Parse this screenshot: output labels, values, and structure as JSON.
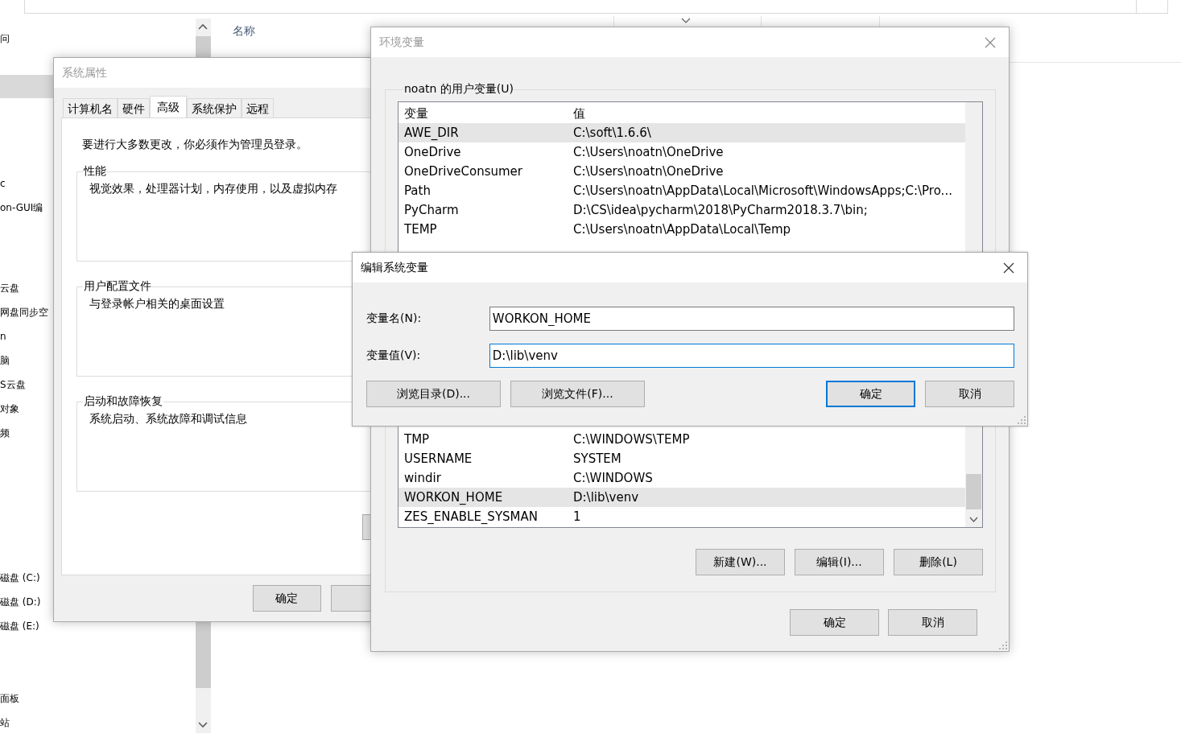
{
  "explorer": {
    "sidebar_sections": [
      {
        "items": [
          "问"
        ]
      },
      {
        "items": [
          "c",
          "on-GUI编"
        ]
      },
      {
        "items": [
          "云盘",
          "网盘同步空",
          "n",
          "脑",
          "S云盘",
          "对象",
          "频"
        ]
      },
      {
        "items": [
          "磁盘 (C:)",
          "磁盘 (D:)",
          "磁盘 (E:)"
        ]
      },
      {
        "items": [
          "面板",
          "站"
        ]
      }
    ],
    "column_header": "名称"
  },
  "system_properties": {
    "title": "系统属性",
    "tabs": [
      {
        "label": "计算机名",
        "selected": false
      },
      {
        "label": "硬件",
        "selected": false
      },
      {
        "label": "高级",
        "selected": true
      },
      {
        "label": "系统保护",
        "selected": false
      },
      {
        "label": "远程",
        "selected": false
      }
    ],
    "notice": "要进行大多数更改，你必须作为管理员登录。",
    "groups": [
      {
        "title": "性能",
        "description": "视觉效果，处理器计划，内存使用，以及虚拟内存"
      },
      {
        "title": "用户配置文件",
        "description": "与登录帐户相关的桌面设置"
      },
      {
        "title": "启动和故障恢复",
        "description": "系统启动、系统故障和调试信息"
      }
    ],
    "buttons": [
      "确定"
    ]
  },
  "environment_variables": {
    "title": "环境变量",
    "user_group_label": "noatn 的用户变量(U)",
    "user_variables": {
      "columns": [
        "变量",
        "值"
      ],
      "rows": [
        {
          "name": "AWE_DIR",
          "value": "C:\\soft\\1.6.6\\",
          "selected": true
        },
        {
          "name": "OneDrive",
          "value": "C:\\Users\\noatn\\OneDrive",
          "selected": false
        },
        {
          "name": "OneDriveConsumer",
          "value": "C:\\Users\\noatn\\OneDrive",
          "selected": false
        },
        {
          "name": "Path",
          "value": "C:\\Users\\noatn\\AppData\\Local\\Microsoft\\WindowsApps;C:\\Pro...",
          "selected": false
        },
        {
          "name": "PyCharm",
          "value": "D:\\CS\\idea\\pycharm\\2018\\PyCharm2018.3.7\\bin;",
          "selected": false
        },
        {
          "name": "TEMP",
          "value": "C:\\Users\\noatn\\AppData\\Local\\Temp",
          "selected": false
        }
      ]
    },
    "system_variables": {
      "rows": [
        {
          "name": "TMP",
          "value": "C:\\WINDOWS\\TEMP",
          "selected": false
        },
        {
          "name": "USERNAME",
          "value": "SYSTEM",
          "selected": false
        },
        {
          "name": "windir",
          "value": "C:\\WINDOWS",
          "selected": false
        },
        {
          "name": "WORKON_HOME",
          "value": "D:\\lib\\venv",
          "selected": true
        },
        {
          "name": "ZES_ENABLE_SYSMAN",
          "value": "1",
          "selected": false
        }
      ]
    },
    "list_buttons": [
      "新建(W)...",
      "编辑(I)...",
      "删除(L)"
    ],
    "buttons": [
      "确定",
      "取消"
    ]
  },
  "edit_dialog": {
    "title": "编辑系统变量",
    "fields": [
      {
        "label": "变量名(N):",
        "value": "WORKON_HOME",
        "focused": false
      },
      {
        "label": "变量值(V):",
        "value": "D:\\lib\\venv",
        "focused": true
      }
    ],
    "browse_buttons": [
      "浏览目录(D)...",
      "浏览文件(F)..."
    ],
    "buttons": [
      {
        "label": "确定",
        "default": true
      },
      {
        "label": "取消",
        "default": false
      }
    ]
  }
}
